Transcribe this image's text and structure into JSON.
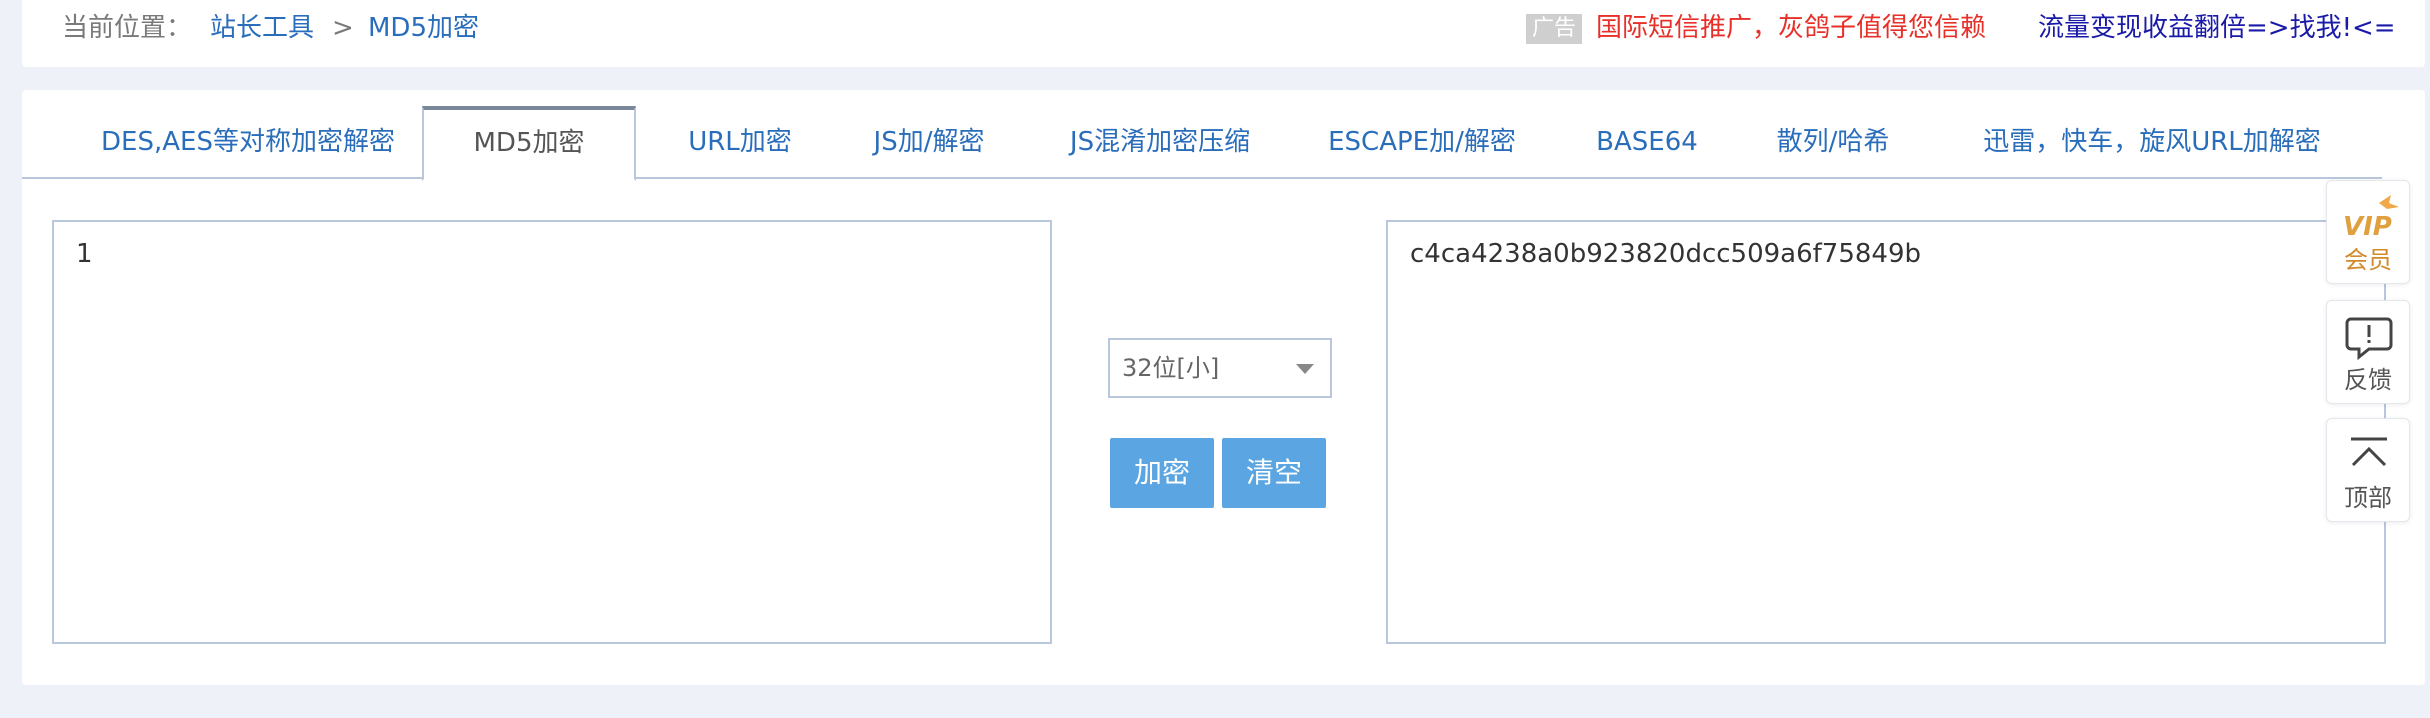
{
  "breadcrumb": {
    "label": "当前位置：",
    "home": "站长工具",
    "separator": ">",
    "current": "MD5加密"
  },
  "ads": {
    "badge": "广告",
    "link1": "国际短信推广，灰鸽子值得您信赖",
    "link2": "流量变现收益翻倍=>找我!<="
  },
  "tabs": [
    {
      "label": "DES,AES等对称加密解密"
    },
    {
      "label": "MD5加密",
      "active": true
    },
    {
      "label": "URL加密"
    },
    {
      "label": "JS加/解密"
    },
    {
      "label": "JS混淆加密压缩"
    },
    {
      "label": "ESCAPE加/解密"
    },
    {
      "label": "BASE64"
    },
    {
      "label": "散列/哈希"
    },
    {
      "label": "迅雷，快车，旋风URL加解密"
    }
  ],
  "input": {
    "value": "1"
  },
  "output": {
    "value": "c4ca4238a0b923820dcc509a6f75849b"
  },
  "select": {
    "value": "32位[小]"
  },
  "buttons": {
    "encrypt": "加密",
    "clear": "清空"
  },
  "float_bar": {
    "vip": "会员",
    "vip_icon_text": "VIP",
    "feedback": "反馈",
    "top": "顶部"
  },
  "colors": {
    "link": "#2a6ebb",
    "ad_red": "#e8302a",
    "ad_blue": "#1a1aa8",
    "button": "#5ba6e2",
    "border": "#b9c7dc",
    "vip": "#d18a2a"
  },
  "icons": [
    "vip-icon",
    "feedback-icon",
    "back-to-top-icon",
    "chevron-down-icon"
  ]
}
